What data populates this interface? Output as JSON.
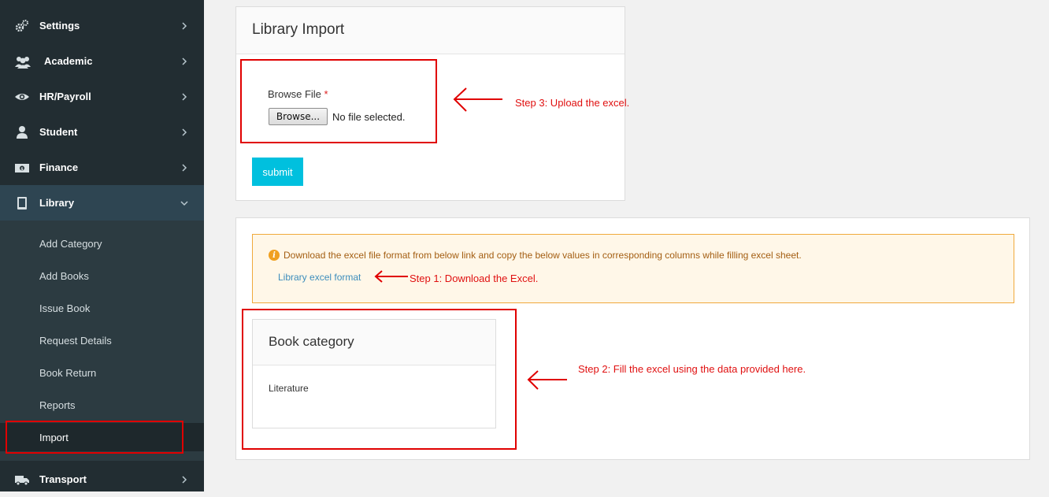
{
  "sidebar": {
    "items": [
      {
        "label": "Settings",
        "icon": "cogs-icon"
      },
      {
        "label": "Academic",
        "icon": "users-icon"
      },
      {
        "label": "HR/Payroll",
        "icon": "eye-icon"
      },
      {
        "label": "Student",
        "icon": "user-icon"
      },
      {
        "label": "Finance",
        "icon": "money-icon"
      },
      {
        "label": "Library",
        "icon": "book-icon"
      },
      {
        "label": "Transport",
        "icon": "truck-icon"
      }
    ],
    "library_submenu": [
      "Add Category",
      "Add Books",
      "Issue Book",
      "Request Details",
      "Book Return",
      "Reports",
      "Import"
    ]
  },
  "import_panel": {
    "title": "Library Import",
    "browse_label": "Browse File",
    "required_mark": "*",
    "browse_button": "Browse...",
    "no_file_text": "No file selected.",
    "submit_label": "submit"
  },
  "info_box": {
    "message": "Download the excel file format from below link and copy the below values in corresponding columns while filling excel sheet.",
    "link_text": "Library excel format"
  },
  "category_panel": {
    "title": "Book category",
    "items": [
      "Literature"
    ]
  },
  "annotations": {
    "step1": "Step 1: Download the Excel.",
    "step2": "Step 2: Fill the excel using the data provided here.",
    "step3": "Step 3: Upload the excel."
  },
  "colors": {
    "sidebar_bg": "#222d32",
    "accent": "#00c0de",
    "annotation": "#e00000"
  }
}
